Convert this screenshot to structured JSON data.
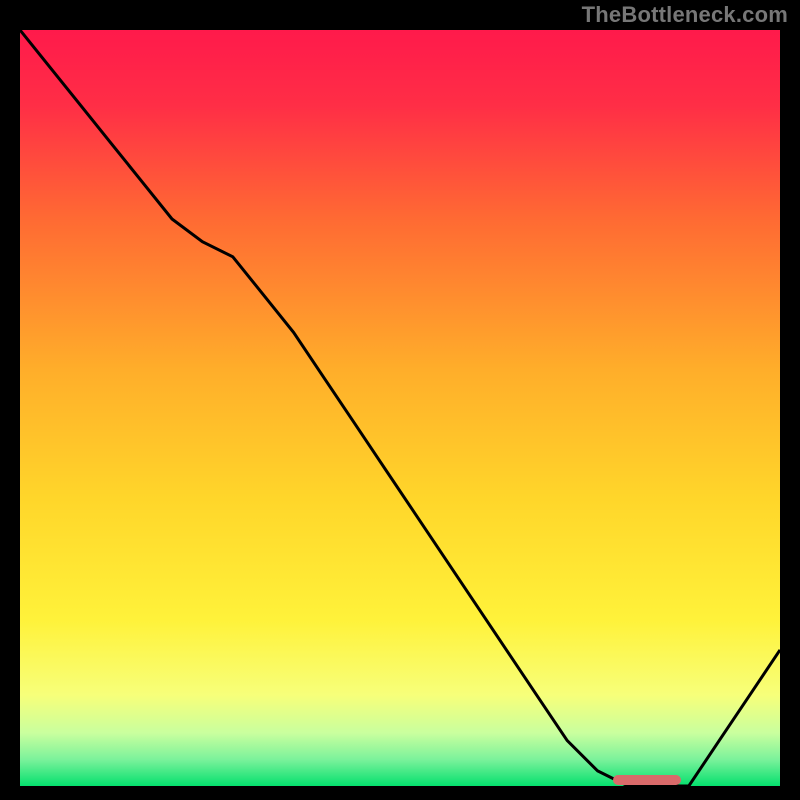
{
  "watermark": "TheBottleneck.com",
  "chart_data": {
    "type": "line",
    "x": [
      0.0,
      0.04,
      0.08,
      0.12,
      0.16,
      0.2,
      0.24,
      0.28,
      0.32,
      0.36,
      0.4,
      0.44,
      0.48,
      0.52,
      0.56,
      0.6,
      0.64,
      0.68,
      0.72,
      0.76,
      0.8,
      0.82,
      0.84,
      0.86,
      0.88,
      0.92,
      0.96,
      1.0
    ],
    "values": [
      1.0,
      0.95,
      0.9,
      0.85,
      0.8,
      0.75,
      0.72,
      0.7,
      0.65,
      0.6,
      0.54,
      0.48,
      0.42,
      0.36,
      0.3,
      0.24,
      0.18,
      0.12,
      0.06,
      0.02,
      0.0,
      0.0,
      0.0,
      0.0,
      0.0,
      0.06,
      0.12,
      0.18
    ],
    "xlim": [
      0,
      1
    ],
    "ylim": [
      0,
      1
    ],
    "title": "",
    "xlabel": "",
    "ylabel": "",
    "gradient_stops": [
      {
        "pos": 0.0,
        "color": "#ff1a4b"
      },
      {
        "pos": 0.1,
        "color": "#ff2e46"
      },
      {
        "pos": 0.25,
        "color": "#ff6a33"
      },
      {
        "pos": 0.45,
        "color": "#ffae2a"
      },
      {
        "pos": 0.62,
        "color": "#ffd62a"
      },
      {
        "pos": 0.78,
        "color": "#fff23a"
      },
      {
        "pos": 0.88,
        "color": "#f7ff7a"
      },
      {
        "pos": 0.93,
        "color": "#c9ff9e"
      },
      {
        "pos": 0.965,
        "color": "#7bf29b"
      },
      {
        "pos": 1.0,
        "color": "#05e06e"
      }
    ],
    "marker": {
      "x_start": 0.78,
      "x_end": 0.87,
      "y": 0.0,
      "color": "#d96a6a"
    },
    "curve_stroke": "#000000",
    "curve_width": 3
  }
}
